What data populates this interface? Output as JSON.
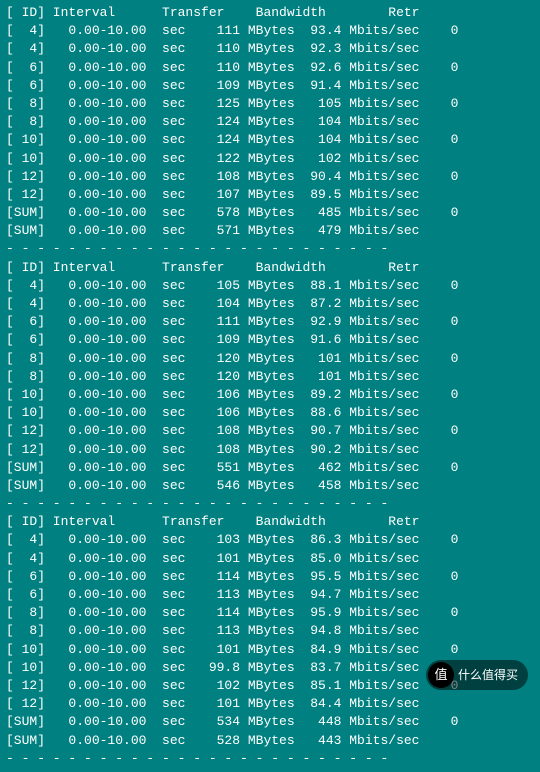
{
  "headers": [
    "ID",
    "Interval",
    "Transfer",
    "Bandwidth",
    "Retr"
  ],
  "blocks": [
    {
      "rows": [
        {
          "id": "  4",
          "interval": "0.00-10.00",
          "unit": "sec",
          "transfer": "111 MBytes",
          "bandwidth": "93.4 Mbits/sec",
          "retr": "0"
        },
        {
          "id": "  4",
          "interval": "0.00-10.00",
          "unit": "sec",
          "transfer": "110 MBytes",
          "bandwidth": "92.3 Mbits/sec",
          "retr": ""
        },
        {
          "id": "  6",
          "interval": "0.00-10.00",
          "unit": "sec",
          "transfer": "110 MBytes",
          "bandwidth": "92.6 Mbits/sec",
          "retr": "0"
        },
        {
          "id": "  6",
          "interval": "0.00-10.00",
          "unit": "sec",
          "transfer": "109 MBytes",
          "bandwidth": "91.4 Mbits/sec",
          "retr": ""
        },
        {
          "id": "  8",
          "interval": "0.00-10.00",
          "unit": "sec",
          "transfer": "125 MBytes",
          "bandwidth": " 105 Mbits/sec",
          "retr": "0"
        },
        {
          "id": "  8",
          "interval": "0.00-10.00",
          "unit": "sec",
          "transfer": "124 MBytes",
          "bandwidth": " 104 Mbits/sec",
          "retr": ""
        },
        {
          "id": " 10",
          "interval": "0.00-10.00",
          "unit": "sec",
          "transfer": "124 MBytes",
          "bandwidth": " 104 Mbits/sec",
          "retr": "0"
        },
        {
          "id": " 10",
          "interval": "0.00-10.00",
          "unit": "sec",
          "transfer": "122 MBytes",
          "bandwidth": " 102 Mbits/sec",
          "retr": ""
        },
        {
          "id": " 12",
          "interval": "0.00-10.00",
          "unit": "sec",
          "transfer": "108 MBytes",
          "bandwidth": "90.4 Mbits/sec",
          "retr": "0"
        },
        {
          "id": " 12",
          "interval": "0.00-10.00",
          "unit": "sec",
          "transfer": "107 MBytes",
          "bandwidth": "89.5 Mbits/sec",
          "retr": ""
        },
        {
          "id": "SUM",
          "interval": "0.00-10.00",
          "unit": "sec",
          "transfer": "578 MBytes",
          "bandwidth": " 485 Mbits/sec",
          "retr": "0"
        },
        {
          "id": "SUM",
          "interval": "0.00-10.00",
          "unit": "sec",
          "transfer": "571 MBytes",
          "bandwidth": " 479 Mbits/sec",
          "retr": ""
        }
      ]
    },
    {
      "rows": [
        {
          "id": "  4",
          "interval": "0.00-10.00",
          "unit": "sec",
          "transfer": "105 MBytes",
          "bandwidth": "88.1 Mbits/sec",
          "retr": "0"
        },
        {
          "id": "  4",
          "interval": "0.00-10.00",
          "unit": "sec",
          "transfer": "104 MBytes",
          "bandwidth": "87.2 Mbits/sec",
          "retr": ""
        },
        {
          "id": "  6",
          "interval": "0.00-10.00",
          "unit": "sec",
          "transfer": "111 MBytes",
          "bandwidth": "92.9 Mbits/sec",
          "retr": "0"
        },
        {
          "id": "  6",
          "interval": "0.00-10.00",
          "unit": "sec",
          "transfer": "109 MBytes",
          "bandwidth": "91.6 Mbits/sec",
          "retr": ""
        },
        {
          "id": "  8",
          "interval": "0.00-10.00",
          "unit": "sec",
          "transfer": "120 MBytes",
          "bandwidth": " 101 Mbits/sec",
          "retr": "0"
        },
        {
          "id": "  8",
          "interval": "0.00-10.00",
          "unit": "sec",
          "transfer": "120 MBytes",
          "bandwidth": " 101 Mbits/sec",
          "retr": ""
        },
        {
          "id": " 10",
          "interval": "0.00-10.00",
          "unit": "sec",
          "transfer": "106 MBytes",
          "bandwidth": "89.2 Mbits/sec",
          "retr": "0"
        },
        {
          "id": " 10",
          "interval": "0.00-10.00",
          "unit": "sec",
          "transfer": "106 MBytes",
          "bandwidth": "88.6 Mbits/sec",
          "retr": ""
        },
        {
          "id": " 12",
          "interval": "0.00-10.00",
          "unit": "sec",
          "transfer": "108 MBytes",
          "bandwidth": "90.7 Mbits/sec",
          "retr": "0"
        },
        {
          "id": " 12",
          "interval": "0.00-10.00",
          "unit": "sec",
          "transfer": "108 MBytes",
          "bandwidth": "90.2 Mbits/sec",
          "retr": ""
        },
        {
          "id": "SUM",
          "interval": "0.00-10.00",
          "unit": "sec",
          "transfer": "551 MBytes",
          "bandwidth": " 462 Mbits/sec",
          "retr": "0"
        },
        {
          "id": "SUM",
          "interval": "0.00-10.00",
          "unit": "sec",
          "transfer": "546 MBytes",
          "bandwidth": " 458 Mbits/sec",
          "retr": ""
        }
      ]
    },
    {
      "rows": [
        {
          "id": "  4",
          "interval": "0.00-10.00",
          "unit": "sec",
          "transfer": "103 MBytes",
          "bandwidth": "86.3 Mbits/sec",
          "retr": "0"
        },
        {
          "id": "  4",
          "interval": "0.00-10.00",
          "unit": "sec",
          "transfer": "101 MBytes",
          "bandwidth": "85.0 Mbits/sec",
          "retr": ""
        },
        {
          "id": "  6",
          "interval": "0.00-10.00",
          "unit": "sec",
          "transfer": "114 MBytes",
          "bandwidth": "95.5 Mbits/sec",
          "retr": "0"
        },
        {
          "id": "  6",
          "interval": "0.00-10.00",
          "unit": "sec",
          "transfer": "113 MBytes",
          "bandwidth": "94.7 Mbits/sec",
          "retr": ""
        },
        {
          "id": "  8",
          "interval": "0.00-10.00",
          "unit": "sec",
          "transfer": "114 MBytes",
          "bandwidth": "95.9 Mbits/sec",
          "retr": "0"
        },
        {
          "id": "  8",
          "interval": "0.00-10.00",
          "unit": "sec",
          "transfer": "113 MBytes",
          "bandwidth": "94.8 Mbits/sec",
          "retr": ""
        },
        {
          "id": " 10",
          "interval": "0.00-10.00",
          "unit": "sec",
          "transfer": "101 MBytes",
          "bandwidth": "84.9 Mbits/sec",
          "retr": "0"
        },
        {
          "id": " 10",
          "interval": "0.00-10.00",
          "unit": "sec",
          "transfer": "99.8 MBytes",
          "bandwidth": "83.7 Mbits/sec",
          "retr": ""
        },
        {
          "id": " 12",
          "interval": "0.00-10.00",
          "unit": "sec",
          "transfer": "102 MBytes",
          "bandwidth": "85.1 Mbits/sec",
          "retr": "0"
        },
        {
          "id": " 12",
          "interval": "0.00-10.00",
          "unit": "sec",
          "transfer": "101 MBytes",
          "bandwidth": "84.4 Mbits/sec",
          "retr": ""
        },
        {
          "id": "SUM",
          "interval": "0.00-10.00",
          "unit": "sec",
          "transfer": "534 MBytes",
          "bandwidth": " 448 Mbits/sec",
          "retr": "0"
        },
        {
          "id": "SUM",
          "interval": "0.00-10.00",
          "unit": "sec",
          "transfer": "528 MBytes",
          "bandwidth": " 443 Mbits/sec",
          "retr": ""
        }
      ]
    }
  ],
  "watermark": {
    "symbol": "值",
    "text": "什么值得买"
  },
  "separator": "- - - - - - - - - - - - - - - - - - - - - - - - -"
}
